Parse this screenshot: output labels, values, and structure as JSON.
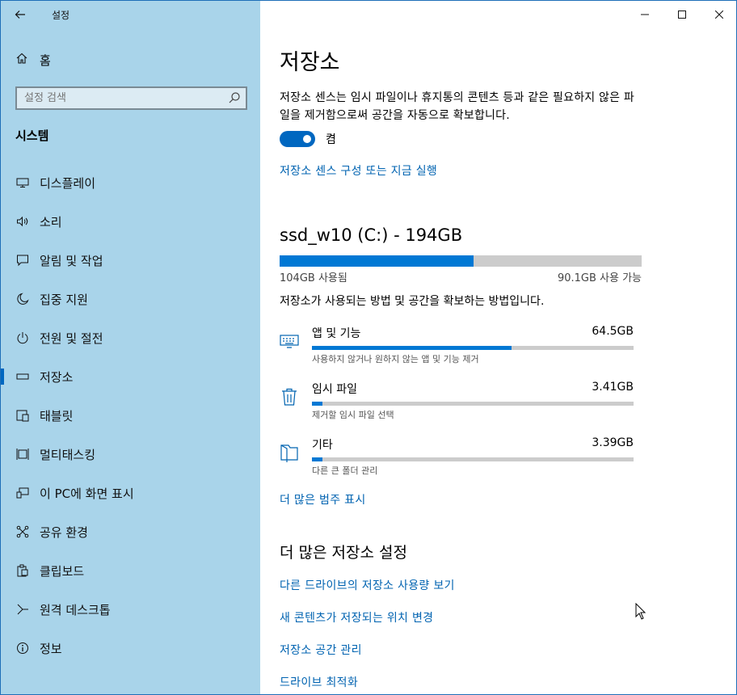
{
  "window": {
    "app_title": "설정"
  },
  "sidebar": {
    "home_label": "홈",
    "search_placeholder": "설정 검색",
    "section_heading": "시스템",
    "items": [
      {
        "label": "디스플레이",
        "icon": "monitor-icon"
      },
      {
        "label": "소리",
        "icon": "speaker-icon"
      },
      {
        "label": "알림 및 작업",
        "icon": "message-icon"
      },
      {
        "label": "집중 지원",
        "icon": "moon-icon"
      },
      {
        "label": "전원 및 절전",
        "icon": "power-icon"
      },
      {
        "label": "저장소",
        "icon": "storage-icon",
        "active": true
      },
      {
        "label": "태블릿",
        "icon": "tablet-icon"
      },
      {
        "label": "멀티태스킹",
        "icon": "multitask-icon"
      },
      {
        "label": "이 PC에 화면 표시",
        "icon": "project-icon"
      },
      {
        "label": "공유 환경",
        "icon": "share-icon"
      },
      {
        "label": "클립보드",
        "icon": "clipboard-icon"
      },
      {
        "label": "원격 데스크톱",
        "icon": "remote-icon"
      },
      {
        "label": "정보",
        "icon": "info-icon"
      }
    ]
  },
  "main": {
    "title": "저장소",
    "description": "저장소 센스는 임시 파일이나 휴지통의 콘텐츠 등과 같은 필요하지 않은 파일을 제거함으로써 공간을 자동으로 확보합니다.",
    "toggle_label": "켬",
    "toggle_on": true,
    "configure_link": "저장소 센스 구성 또는 지금 실행",
    "drive": {
      "title": "ssd_w10 (C:) - 194GB",
      "used_label": "104GB 사용됨",
      "available_label": "90.1GB 사용 가능",
      "used_fraction": 0.536
    },
    "usage_description": "저장소가 사용되는 방법 및 공간을 확보하는 방법입니다.",
    "categories": [
      {
        "name": "앱 및 기능",
        "size": "64.5GB",
        "sub": "사용하지 않거나 원하지 않는 앱 및 기능 제거",
        "fraction": 0.62,
        "icon": "keyboard-icon"
      },
      {
        "name": "임시 파일",
        "size": "3.41GB",
        "sub": "제거할 임시 파일 선택",
        "fraction": 0.033,
        "icon": "trash-icon"
      },
      {
        "name": "기타",
        "size": "3.39GB",
        "sub": "다른 큰 폴더 관리",
        "fraction": 0.033,
        "icon": "folder-icon"
      }
    ],
    "show_more_link": "더 많은 범주 표시",
    "more_settings_heading": "더 많은 저장소 설정",
    "more_links": [
      "다른 드라이브의 저장소 사용량 보기",
      "새 콘텐츠가 저장되는 위치 변경",
      "저장소 공간 관리",
      "드라이브 최적화"
    ]
  }
}
